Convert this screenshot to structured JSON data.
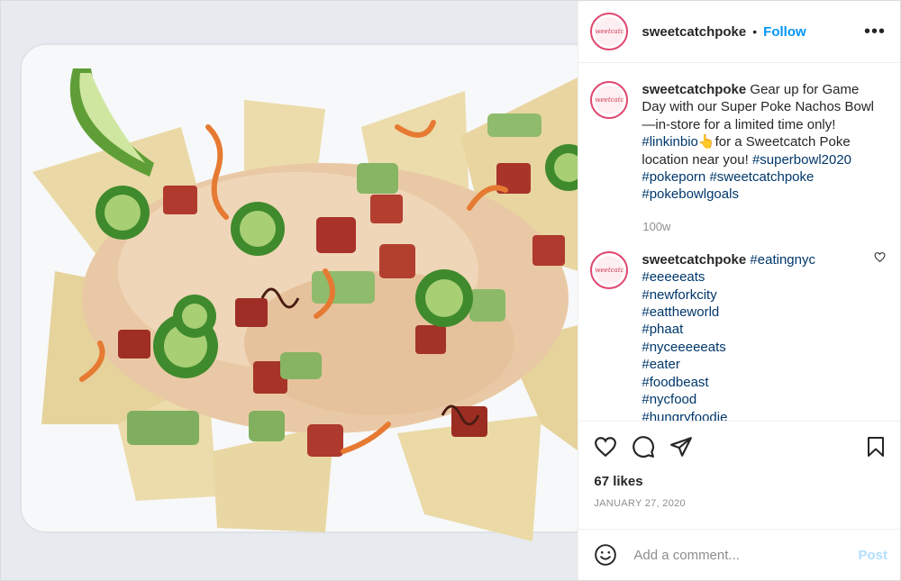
{
  "post": {
    "username": "sweetcatchpoke",
    "follow_label": "Follow",
    "separator": "•",
    "more_label": "•••",
    "avatar_text": "Sweetcatch",
    "caption": {
      "username": "sweetcatchpoke",
      "text_1": " Gear up for Game Day with our Super Poke Nachos Bowl—in-store for a limited time only! ",
      "tag_1": "#linkinbio",
      "emoji": "👆",
      "text_2": "for a Sweetcatch Poke location near you! ",
      "tag_2": "#superbowl2020",
      "tag_3": "#pokeporn",
      "tag_4": "#sweetcatchpoke",
      "tag_5": "#pokebowlgoals",
      "age": "100w"
    },
    "comment": {
      "username": "sweetcatchpoke",
      "tags": [
        "#eatingnyc",
        "#eeeeeats",
        "#newforkcity",
        "#eattheworld",
        "#phaat",
        "#nyceeeeeats",
        "#eater",
        "#foodbeast",
        "#nycfood",
        "#hungryfoodie"
      ]
    },
    "likes": "67 likes",
    "date": "JANUARY 27, 2020",
    "comment_placeholder": "Add a comment...",
    "post_label": "Post"
  },
  "icons": {
    "like": "heart-icon",
    "comment": "comment-icon",
    "share": "share-icon",
    "save": "bookmark-icon",
    "emoji": "smiley-icon",
    "more": "more-options-icon"
  },
  "colors": {
    "link_blue": "#0095f6",
    "hashtag": "#00376b",
    "muted": "#8e8e8e",
    "post_disabled": "#b2dffc"
  }
}
